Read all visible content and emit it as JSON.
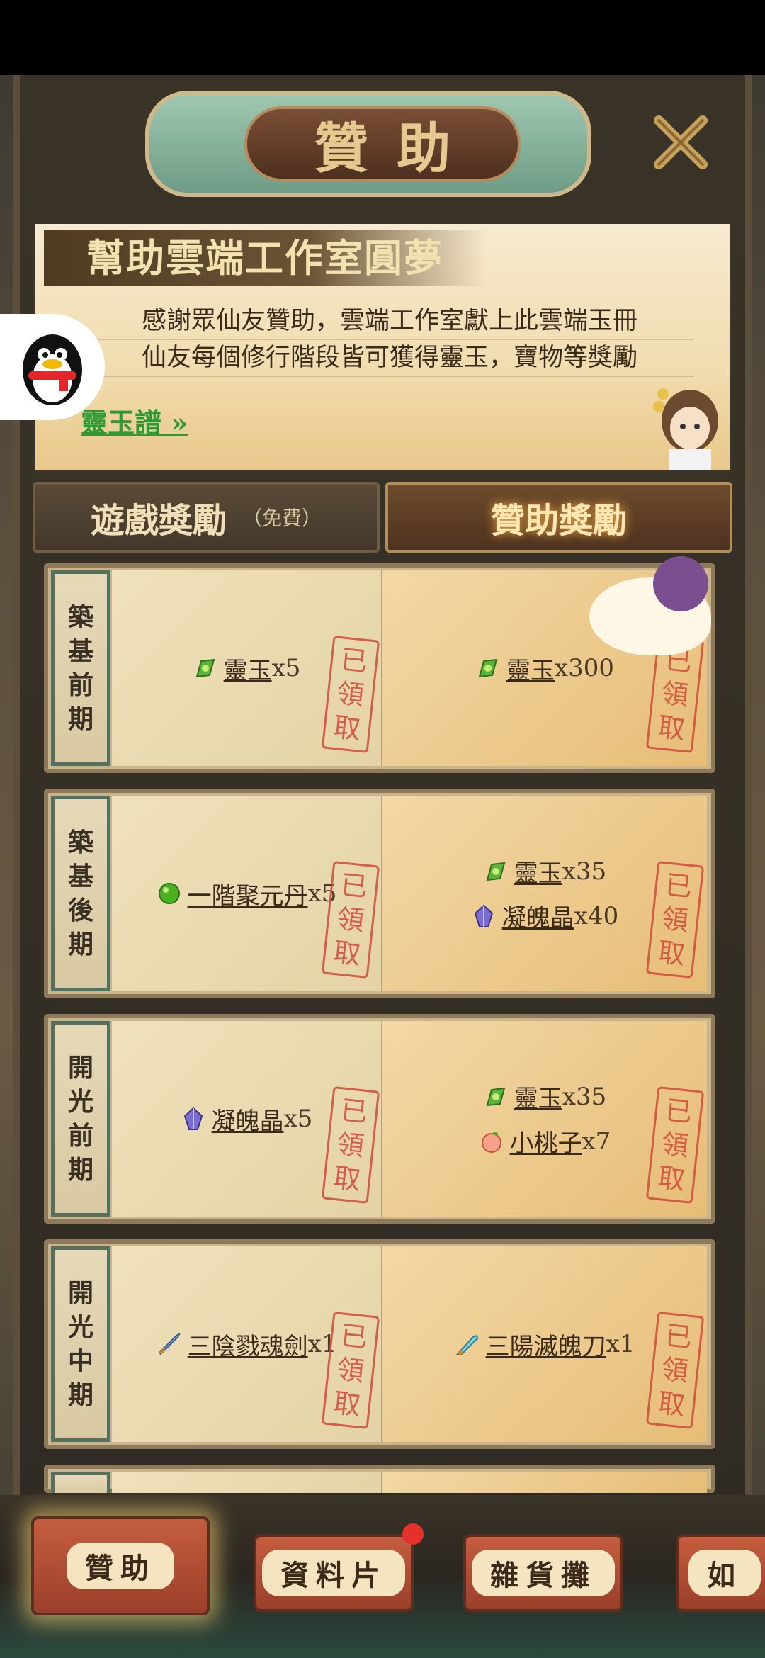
{
  "header": {
    "title": "贊助"
  },
  "banner": {
    "title": "幫助雲端工作室圓夢",
    "line1": "感謝眾仙友贊助，雲端工作室獻上此雲端玉冊",
    "line2": "仙友每個修行階段皆可獲得靈玉，寶物等獎勵",
    "link": "靈玉譜"
  },
  "tabs": {
    "free_label": "遊戲獎勵",
    "free_note": "（免費）",
    "sponsor_label": "贊助獎勵"
  },
  "stamp_text": [
    "已",
    "領",
    "取"
  ],
  "rows": [
    {
      "stage": [
        "築",
        "基",
        "前",
        "期"
      ],
      "free": [
        {
          "name": "靈玉",
          "qty": "x5"
        }
      ],
      "paid": [
        {
          "name": "靈玉",
          "qty": "x300"
        }
      ]
    },
    {
      "stage": [
        "築",
        "基",
        "後",
        "期"
      ],
      "free": [
        {
          "name": "一階聚元丹",
          "qty": "x5"
        }
      ],
      "paid": [
        {
          "name": "靈玉",
          "qty": "x35"
        },
        {
          "name": "凝魄晶",
          "qty": "x40"
        }
      ]
    },
    {
      "stage": [
        "開",
        "光",
        "前",
        "期"
      ],
      "free": [
        {
          "name": "凝魄晶",
          "qty": "x5"
        }
      ],
      "paid": [
        {
          "name": "靈玉",
          "qty": "x35"
        },
        {
          "name": "小桃子",
          "qty": "x7"
        }
      ]
    },
    {
      "stage": [
        "開",
        "光",
        "中",
        "期"
      ],
      "free": [
        {
          "name": "三陰戮魂劍",
          "qty": "x1"
        }
      ],
      "paid": [
        {
          "name": "三陽滅魄刀",
          "qty": "x1"
        }
      ]
    }
  ],
  "bottom_nav": [
    {
      "label": "贊助"
    },
    {
      "label": "資料片"
    },
    {
      "label": "雜貨攤"
    },
    {
      "label": "如"
    }
  ],
  "colors": {
    "accent_green": "#2f9a35",
    "stamp_red": "#d14a3a",
    "notification": "#e4322b"
  }
}
